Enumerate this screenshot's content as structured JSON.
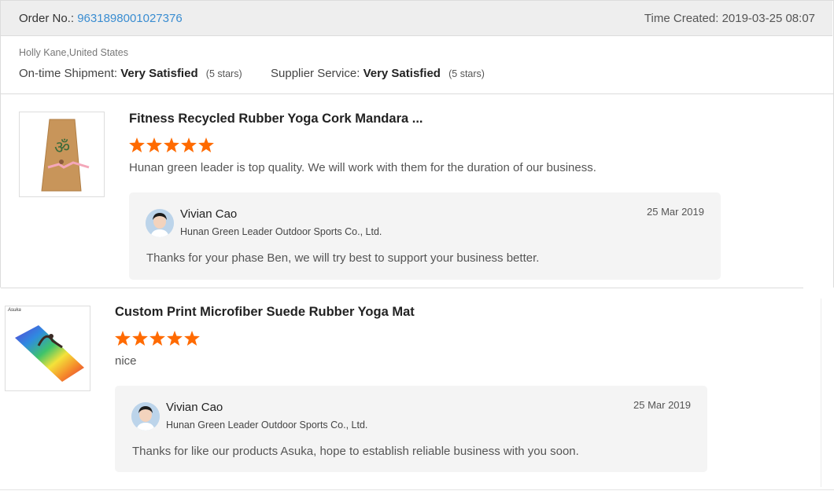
{
  "order": {
    "label": "Order No.:",
    "number": "9631898001027376",
    "time_created": "Time Created: 2019-03-25 08:07"
  },
  "buyer": {
    "name_location": "Holly Kane,United States",
    "shipment_label": "On-time Shipment:",
    "shipment_value": "Very Satisfied",
    "shipment_stars": "(5 stars)",
    "service_label": "Supplier Service:",
    "service_value": "Very Satisfied",
    "service_stars": "(5 stars)"
  },
  "reviews": [
    {
      "product_title": "Fitness Recycled Rubber Yoga Cork Mandara ...",
      "rating": 5,
      "text": "Hunan green leader is top quality. We will work with them for the duration of our business.",
      "reply": {
        "name": "Vivian Cao",
        "company": "Hunan Green Leader Outdoor Sports Co., Ltd.",
        "date": "25 Mar 2019",
        "text": "Thanks for your phase Ben, we will try best to support your business better."
      }
    },
    {
      "product_title": "Custom Print Microfiber Suede Rubber Yoga Mat",
      "rating": 5,
      "text": "nice",
      "image_brand": "Asuka",
      "reply": {
        "name": "Vivian Cao",
        "company": "Hunan Green Leader Outdoor Sports Co., Ltd.",
        "date": "25 Mar 2019",
        "text": "Thanks for like our products Asuka, hope to establish reliable business with you soon."
      }
    }
  ],
  "colors": {
    "star": "#ff6a00",
    "link": "#3a8dd1",
    "header_bg": "#eeeeee",
    "reply_bg": "#f4f4f4"
  },
  "icons": [
    "star-icon",
    "avatar-icon"
  ]
}
